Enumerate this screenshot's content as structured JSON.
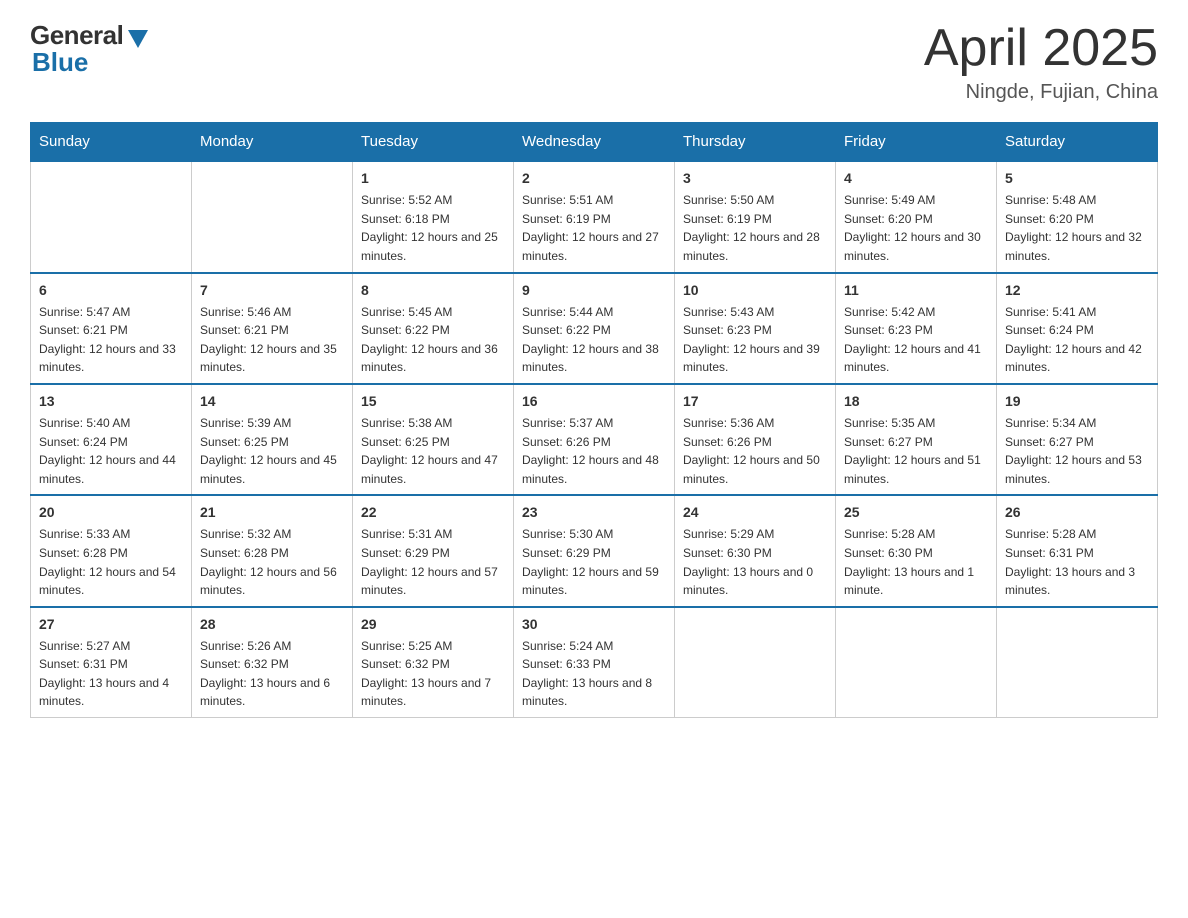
{
  "header": {
    "logo_general": "General",
    "logo_blue": "Blue",
    "month_title": "April 2025",
    "location": "Ningde, Fujian, China"
  },
  "days_of_week": [
    "Sunday",
    "Monday",
    "Tuesday",
    "Wednesday",
    "Thursday",
    "Friday",
    "Saturday"
  ],
  "weeks": [
    [
      {
        "num": "",
        "sunrise": "",
        "sunset": "",
        "daylight": ""
      },
      {
        "num": "",
        "sunrise": "",
        "sunset": "",
        "daylight": ""
      },
      {
        "num": "1",
        "sunrise": "Sunrise: 5:52 AM",
        "sunset": "Sunset: 6:18 PM",
        "daylight": "Daylight: 12 hours and 25 minutes."
      },
      {
        "num": "2",
        "sunrise": "Sunrise: 5:51 AM",
        "sunset": "Sunset: 6:19 PM",
        "daylight": "Daylight: 12 hours and 27 minutes."
      },
      {
        "num": "3",
        "sunrise": "Sunrise: 5:50 AM",
        "sunset": "Sunset: 6:19 PM",
        "daylight": "Daylight: 12 hours and 28 minutes."
      },
      {
        "num": "4",
        "sunrise": "Sunrise: 5:49 AM",
        "sunset": "Sunset: 6:20 PM",
        "daylight": "Daylight: 12 hours and 30 minutes."
      },
      {
        "num": "5",
        "sunrise": "Sunrise: 5:48 AM",
        "sunset": "Sunset: 6:20 PM",
        "daylight": "Daylight: 12 hours and 32 minutes."
      }
    ],
    [
      {
        "num": "6",
        "sunrise": "Sunrise: 5:47 AM",
        "sunset": "Sunset: 6:21 PM",
        "daylight": "Daylight: 12 hours and 33 minutes."
      },
      {
        "num": "7",
        "sunrise": "Sunrise: 5:46 AM",
        "sunset": "Sunset: 6:21 PM",
        "daylight": "Daylight: 12 hours and 35 minutes."
      },
      {
        "num": "8",
        "sunrise": "Sunrise: 5:45 AM",
        "sunset": "Sunset: 6:22 PM",
        "daylight": "Daylight: 12 hours and 36 minutes."
      },
      {
        "num": "9",
        "sunrise": "Sunrise: 5:44 AM",
        "sunset": "Sunset: 6:22 PM",
        "daylight": "Daylight: 12 hours and 38 minutes."
      },
      {
        "num": "10",
        "sunrise": "Sunrise: 5:43 AM",
        "sunset": "Sunset: 6:23 PM",
        "daylight": "Daylight: 12 hours and 39 minutes."
      },
      {
        "num": "11",
        "sunrise": "Sunrise: 5:42 AM",
        "sunset": "Sunset: 6:23 PM",
        "daylight": "Daylight: 12 hours and 41 minutes."
      },
      {
        "num": "12",
        "sunrise": "Sunrise: 5:41 AM",
        "sunset": "Sunset: 6:24 PM",
        "daylight": "Daylight: 12 hours and 42 minutes."
      }
    ],
    [
      {
        "num": "13",
        "sunrise": "Sunrise: 5:40 AM",
        "sunset": "Sunset: 6:24 PM",
        "daylight": "Daylight: 12 hours and 44 minutes."
      },
      {
        "num": "14",
        "sunrise": "Sunrise: 5:39 AM",
        "sunset": "Sunset: 6:25 PM",
        "daylight": "Daylight: 12 hours and 45 minutes."
      },
      {
        "num": "15",
        "sunrise": "Sunrise: 5:38 AM",
        "sunset": "Sunset: 6:25 PM",
        "daylight": "Daylight: 12 hours and 47 minutes."
      },
      {
        "num": "16",
        "sunrise": "Sunrise: 5:37 AM",
        "sunset": "Sunset: 6:26 PM",
        "daylight": "Daylight: 12 hours and 48 minutes."
      },
      {
        "num": "17",
        "sunrise": "Sunrise: 5:36 AM",
        "sunset": "Sunset: 6:26 PM",
        "daylight": "Daylight: 12 hours and 50 minutes."
      },
      {
        "num": "18",
        "sunrise": "Sunrise: 5:35 AM",
        "sunset": "Sunset: 6:27 PM",
        "daylight": "Daylight: 12 hours and 51 minutes."
      },
      {
        "num": "19",
        "sunrise": "Sunrise: 5:34 AM",
        "sunset": "Sunset: 6:27 PM",
        "daylight": "Daylight: 12 hours and 53 minutes."
      }
    ],
    [
      {
        "num": "20",
        "sunrise": "Sunrise: 5:33 AM",
        "sunset": "Sunset: 6:28 PM",
        "daylight": "Daylight: 12 hours and 54 minutes."
      },
      {
        "num": "21",
        "sunrise": "Sunrise: 5:32 AM",
        "sunset": "Sunset: 6:28 PM",
        "daylight": "Daylight: 12 hours and 56 minutes."
      },
      {
        "num": "22",
        "sunrise": "Sunrise: 5:31 AM",
        "sunset": "Sunset: 6:29 PM",
        "daylight": "Daylight: 12 hours and 57 minutes."
      },
      {
        "num": "23",
        "sunrise": "Sunrise: 5:30 AM",
        "sunset": "Sunset: 6:29 PM",
        "daylight": "Daylight: 12 hours and 59 minutes."
      },
      {
        "num": "24",
        "sunrise": "Sunrise: 5:29 AM",
        "sunset": "Sunset: 6:30 PM",
        "daylight": "Daylight: 13 hours and 0 minutes."
      },
      {
        "num": "25",
        "sunrise": "Sunrise: 5:28 AM",
        "sunset": "Sunset: 6:30 PM",
        "daylight": "Daylight: 13 hours and 1 minute."
      },
      {
        "num": "26",
        "sunrise": "Sunrise: 5:28 AM",
        "sunset": "Sunset: 6:31 PM",
        "daylight": "Daylight: 13 hours and 3 minutes."
      }
    ],
    [
      {
        "num": "27",
        "sunrise": "Sunrise: 5:27 AM",
        "sunset": "Sunset: 6:31 PM",
        "daylight": "Daylight: 13 hours and 4 minutes."
      },
      {
        "num": "28",
        "sunrise": "Sunrise: 5:26 AM",
        "sunset": "Sunset: 6:32 PM",
        "daylight": "Daylight: 13 hours and 6 minutes."
      },
      {
        "num": "29",
        "sunrise": "Sunrise: 5:25 AM",
        "sunset": "Sunset: 6:32 PM",
        "daylight": "Daylight: 13 hours and 7 minutes."
      },
      {
        "num": "30",
        "sunrise": "Sunrise: 5:24 AM",
        "sunset": "Sunset: 6:33 PM",
        "daylight": "Daylight: 13 hours and 8 minutes."
      },
      {
        "num": "",
        "sunrise": "",
        "sunset": "",
        "daylight": ""
      },
      {
        "num": "",
        "sunrise": "",
        "sunset": "",
        "daylight": ""
      },
      {
        "num": "",
        "sunrise": "",
        "sunset": "",
        "daylight": ""
      }
    ]
  ]
}
